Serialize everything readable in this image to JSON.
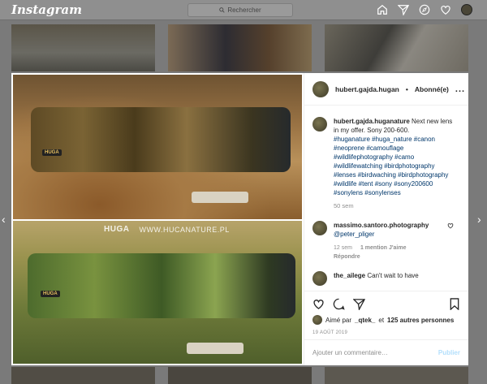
{
  "topbar": {
    "logo": "Instagram",
    "search_placeholder": "Rechercher",
    "icons": [
      "home-icon",
      "direct-icon",
      "explore-icon",
      "heart-icon",
      "profile-avatar"
    ]
  },
  "post": {
    "watermark_logo": "HUGA",
    "watermark_url": "WWW.HUCANATURE.PL",
    "brand_tag": "HUGA",
    "header": {
      "username": "hubert.gajda.hugan",
      "separator": "•",
      "follow_status": "Abonné(e)",
      "more": "..."
    },
    "caption": {
      "username": "hubert.gajda.huganature",
      "text": "Next new lens in my offer. Sony 200-600.",
      "hashtags": "#huganature #huga_nature #canon #neoprene #camouflage #wildlifephotography #camo #wildlifewatching #birdphotography #lenses #birdwaching #birdphotography #wildlife #tent #sony #sony200600 #sonylens #sonylenses",
      "time": "50 sem"
    },
    "comments": [
      {
        "username": "massimo.santoro.photography",
        "mention": "@peter_pliger",
        "time": "12 sem",
        "likes": "1 mention J'aime",
        "reply": "Répondre"
      },
      {
        "username": "the_ailege",
        "text": "Can't wait to have"
      }
    ],
    "likes": {
      "prefix": "Aimé par",
      "liker": "_qtek_",
      "connector": "et",
      "others": "125 autres personnes"
    },
    "date": "19 AOÛT 2019",
    "comment_placeholder": "Ajouter un commentaire…",
    "publish_label": "Publier"
  },
  "colors": {
    "link": "#00376b",
    "muted": "#8e8e8e",
    "publish_disabled": "#b2dffc"
  }
}
